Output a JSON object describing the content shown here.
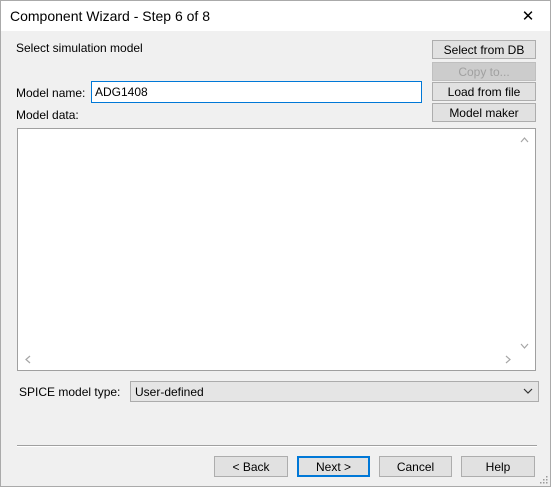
{
  "window": {
    "title": "Component Wizard - Step 6 of 8",
    "close_glyph": "✕"
  },
  "section_heading": "Select simulation model",
  "model_name": {
    "label": "Model name:",
    "value": "ADG1408"
  },
  "model_data": {
    "label": "Model data:",
    "content": ""
  },
  "side_buttons": {
    "select_from_db": "Select from DB",
    "copy_to": "Copy to...",
    "load_from_file": "Load from file",
    "model_maker": "Model maker"
  },
  "spice": {
    "label": "SPICE model type:",
    "selected": "User-defined"
  },
  "footer_buttons": {
    "back": "< Back",
    "next": "Next >",
    "cancel": "Cancel",
    "help": "Help"
  },
  "colors": {
    "accent": "#0078d7",
    "dialog_bg": "#f0f0f0",
    "disabled_text": "#a0a0a0"
  },
  "icons": {
    "close": "close-icon",
    "scroll_up": "scroll-up-arrow-icon",
    "scroll_down": "scroll-down-arrow-icon",
    "scroll_left": "scroll-left-arrow-icon",
    "scroll_right": "scroll-right-arrow-icon",
    "dropdown": "chevron-down-icon",
    "size_grip": "size-grip-icon"
  }
}
